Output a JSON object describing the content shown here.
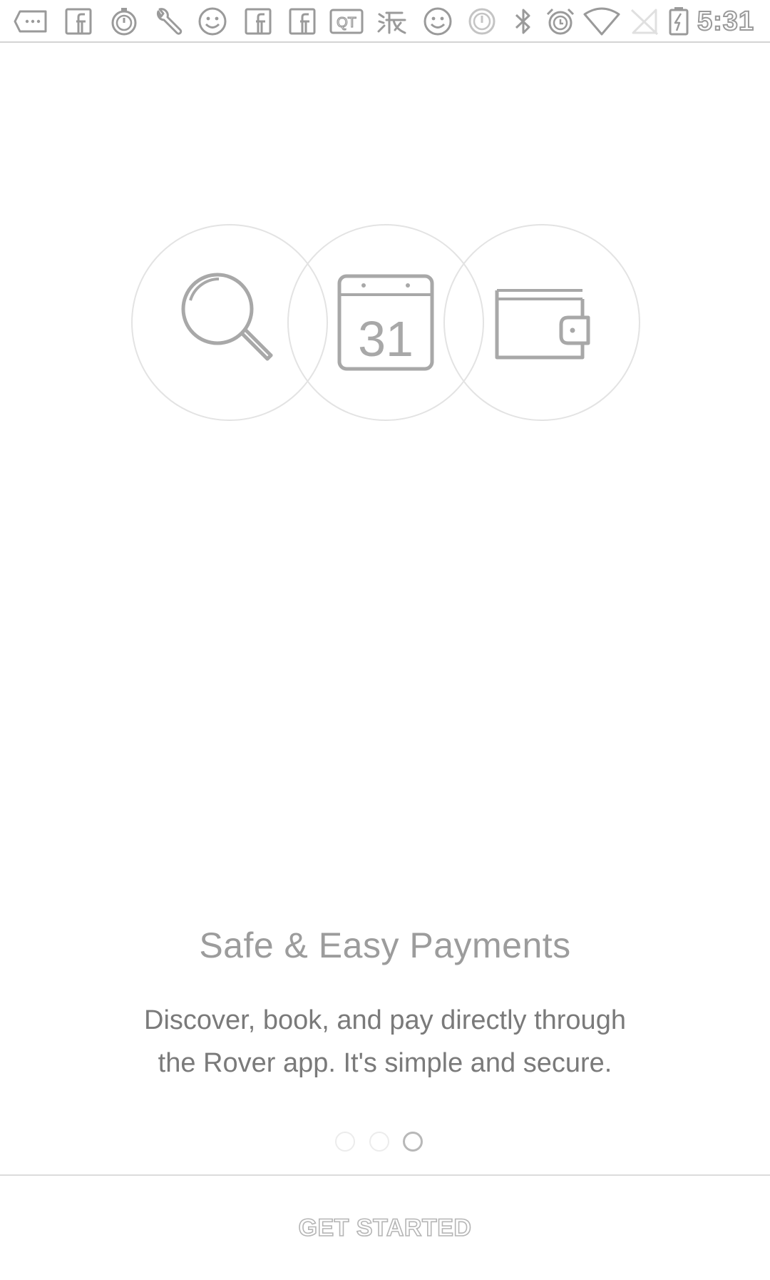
{
  "status_bar": {
    "time": "5:31",
    "icons": [
      "message-icon",
      "facebook-icon",
      "timer-icon",
      "wrench-icon",
      "smiley-icon",
      "facebook-icon",
      "facebook-icon",
      "qt-icon",
      "taobao-icon",
      "smiley-icon",
      "power-icon",
      "bluetooth-icon",
      "alarm-icon",
      "wifi-icon",
      "no-signal-icon",
      "battery-charging-icon"
    ]
  },
  "hero": {
    "icons": [
      "search-icon",
      "calendar-icon",
      "wallet-icon"
    ],
    "calendar_day": "31"
  },
  "onboarding": {
    "headline": "Safe & Easy Payments",
    "description": "Discover, book, and pay directly through the Rover app. It's simple and secure."
  },
  "pager": {
    "total": 3,
    "active_index": 2
  },
  "footer": {
    "cta_label": "GET STARTED"
  },
  "colors": {
    "background": "#ffffff",
    "text_headline": "#9c9c9c",
    "text_body": "#7a7a7a",
    "icon_stroke": "#a8a8a8",
    "circle_border": "#e3e3e3"
  }
}
